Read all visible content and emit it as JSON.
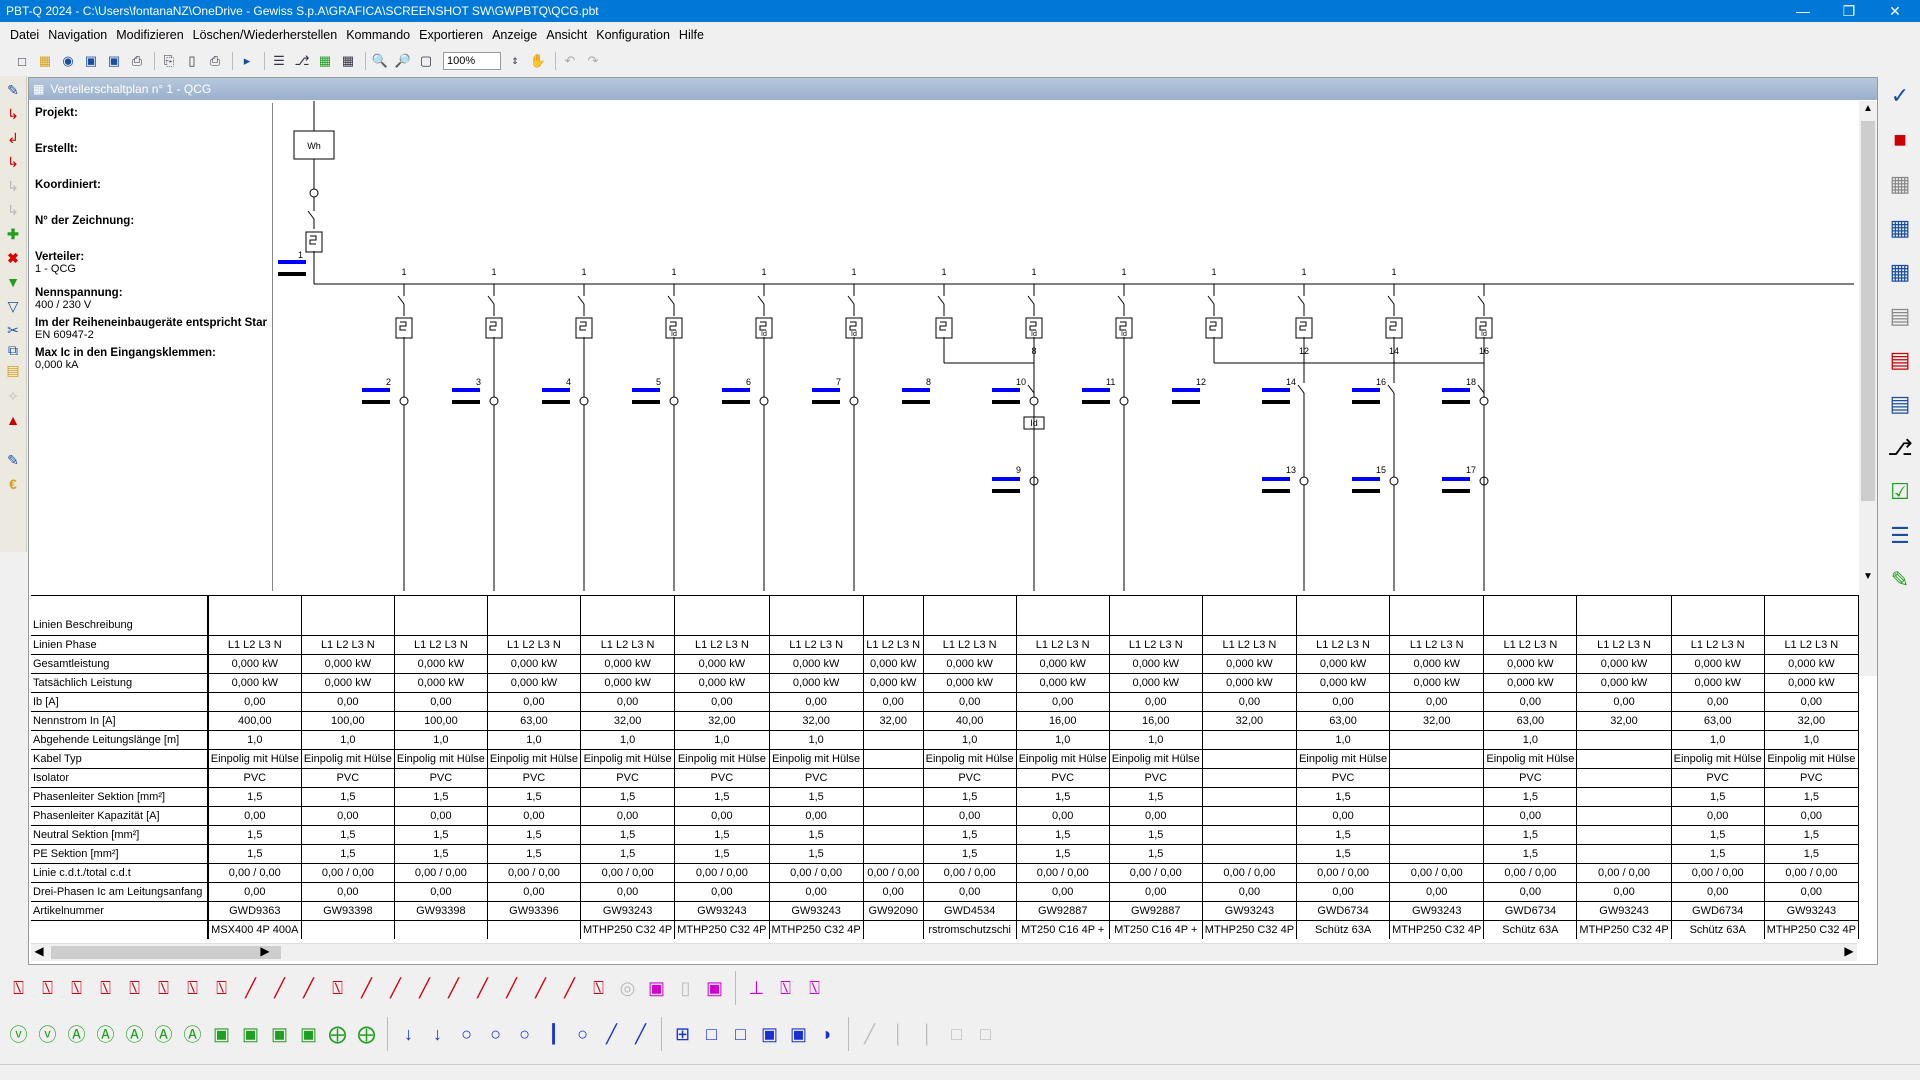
{
  "window": {
    "title": "PBT-Q 2024 - C:\\Users\\fontanaNZ\\OneDrive - Gewiss S.p.A\\GRAFICA\\SCREENSHOT SW\\GWPBTQ\\QCG.pbt"
  },
  "menu": [
    "Datei",
    "Navigation",
    "Modifizieren",
    "Löschen/Wiederherstellen",
    "Kommando",
    "Exportieren",
    "Anzeige",
    "Ansicht",
    "Konfiguration",
    "Hilfe"
  ],
  "toolbar": {
    "zoom": "100%"
  },
  "panel": {
    "title": "Verteilerschaltplan n° 1 - QCG"
  },
  "info": {
    "projekt": "Projekt:",
    "erstellt": "Erstellt:",
    "koordiniert": "Koordiniert:",
    "zeichnung": "N° der Zeichnung:",
    "verteiler_label": "Verteiler:",
    "verteiler_value": "1 - QCG",
    "nennspannung_label": "Nennspannung:",
    "nennspannung_value": "400 / 230 V",
    "reihen_label": "Im der Reiheneinbaugeräte entspricht Star",
    "reihen_value": "EN 60947-2",
    "maxic_label": "Max Ic in den Eingangsklemmen:",
    "maxic_value": "0,000 kA"
  },
  "diagram": {
    "meter": "Wh",
    "main_id": "1",
    "feeders": [
      {
        "id": "2",
        "bus": "1",
        "type": "br"
      },
      {
        "id": "3",
        "bus": "1",
        "type": "br"
      },
      {
        "id": "4",
        "bus": "1",
        "type": "br"
      },
      {
        "id": "5",
        "bus": "1",
        "type": "bd"
      },
      {
        "id": "6",
        "bus": "1",
        "type": "bd"
      },
      {
        "id": "7",
        "bus": "1",
        "type": "bd"
      },
      {
        "id": "8",
        "bus": "1",
        "type": "sub",
        "sub": "8",
        "low": "9"
      },
      {
        "id": "10",
        "bus": "1",
        "type": "bd"
      },
      {
        "id": "11",
        "bus": "1",
        "type": "bd"
      },
      {
        "id": "12",
        "bus": "1",
        "type": "sub",
        "sub": "12",
        "low": "13"
      },
      {
        "id": "14",
        "bus": "1",
        "type": "sub",
        "sub": "14",
        "low": "15"
      },
      {
        "id": "16",
        "bus": "1",
        "type": "sub",
        "sub": "16",
        "low": "17"
      },
      {
        "id": "18",
        "bus": "",
        "type": "bd"
      }
    ]
  },
  "grid": {
    "row_labels": [
      "Linien Beschreibung",
      "Linien Phase",
      "Gesamtleistung",
      "Tatsächlich Leistung",
      "Ib [A]",
      "Nennstrom In [A]",
      "Abgehende Leitungslänge [m]",
      "Kabel Typ",
      "Isolator",
      "Phasenleiter Sektion [mm²]",
      "Phasenleiter Kapazität [A]",
      "Neutral Sektion [mm²]",
      "PE Sektion [mm²]",
      "Linie c.d.t./total c.d.t",
      "Drei-Phasen Ic am Leitungsanfang",
      "Artikelnummer",
      ""
    ],
    "columns": [
      [
        "",
        "L1 L2 L3 N",
        "0,000 kW",
        "0,000 kW",
        "0,00",
        "400,00",
        "1,0",
        "Einpolig mit Hülse",
        "PVC",
        "1,5",
        "0,00",
        "1,5",
        "1,5",
        "0,00 / 0,00",
        "0,00",
        "GWD9363",
        "MSX400 4P 400A"
      ],
      [
        "",
        "L1 L2 L3 N",
        "0,000 kW",
        "0,000 kW",
        "0,00",
        "100,00",
        "1,0",
        "Einpolig mit Hülse",
        "PVC",
        "1,5",
        "0,00",
        "1,5",
        "1,5",
        "0,00 / 0,00",
        "0,00",
        "GW93398",
        ""
      ],
      [
        "",
        "L1 L2 L3 N",
        "0,000 kW",
        "0,000 kW",
        "0,00",
        "100,00",
        "1,0",
        "Einpolig mit Hülse",
        "PVC",
        "1,5",
        "0,00",
        "1,5",
        "1,5",
        "0,00 / 0,00",
        "0,00",
        "GW93398",
        ""
      ],
      [
        "",
        "L1 L2 L3 N",
        "0,000 kW",
        "0,000 kW",
        "0,00",
        "63,00",
        "1,0",
        "Einpolig mit Hülse",
        "PVC",
        "1,5",
        "0,00",
        "1,5",
        "1,5",
        "0,00 / 0,00",
        "0,00",
        "GW93396",
        ""
      ],
      [
        "",
        "L1 L2 L3 N",
        "0,000 kW",
        "0,000 kW",
        "0,00",
        "32,00",
        "1,0",
        "Einpolig mit Hülse",
        "PVC",
        "1,5",
        "0,00",
        "1,5",
        "1,5",
        "0,00 / 0,00",
        "0,00",
        "GW93243",
        "MTHP250 C32 4P"
      ],
      [
        "",
        "L1 L2 L3 N",
        "0,000 kW",
        "0,000 kW",
        "0,00",
        "32,00",
        "1,0",
        "Einpolig mit Hülse",
        "PVC",
        "1,5",
        "0,00",
        "1,5",
        "1,5",
        "0,00 / 0,00",
        "0,00",
        "GW93243",
        "MTHP250 C32 4P"
      ],
      [
        "",
        "L1 L2 L3 N",
        "0,000 kW",
        "0,000 kW",
        "0,00",
        "32,00",
        "1,0",
        "Einpolig mit Hülse",
        "PVC",
        "1,5",
        "0,00",
        "1,5",
        "1,5",
        "0,00 / 0,00",
        "0,00",
        "GW93243",
        "MTHP250 C32 4P"
      ],
      [
        "",
        "L1 L2 L3 N",
        "0,000 kW",
        "0,000 kW",
        "0,00",
        "32,00",
        "",
        "",
        "",
        "",
        "",
        "",
        "",
        "0,00 / 0,00",
        "0,00",
        "GW92090",
        ""
      ],
      [
        "",
        "L1 L2 L3 N",
        "0,000 kW",
        "0,000 kW",
        "0,00",
        "40,00",
        "1,0",
        "Einpolig mit Hülse",
        "PVC",
        "1,5",
        "0,00",
        "1,5",
        "1,5",
        "0,00 / 0,00",
        "0,00",
        "GWD4534",
        "rstromschutzschi"
      ],
      [
        "",
        "L1 L2 L3 N",
        "0,000 kW",
        "0,000 kW",
        "0,00",
        "16,00",
        "1,0",
        "Einpolig mit Hülse",
        "PVC",
        "1,5",
        "0,00",
        "1,5",
        "1,5",
        "0,00 / 0,00",
        "0,00",
        "GW92887",
        "MT250 C16 4P +"
      ],
      [
        "",
        "L1 L2 L3 N",
        "0,000 kW",
        "0,000 kW",
        "0,00",
        "16,00",
        "1,0",
        "Einpolig mit Hülse",
        "PVC",
        "1,5",
        "0,00",
        "1,5",
        "1,5",
        "0,00 / 0,00",
        "0,00",
        "GW92887",
        "MT250 C16 4P +"
      ],
      [
        "",
        "L1 L2 L3 N",
        "0,000 kW",
        "0,000 kW",
        "0,00",
        "32,00",
        "",
        "",
        "",
        "",
        "",
        "",
        "",
        "0,00 / 0,00",
        "0,00",
        "GW93243",
        "MTHP250 C32 4P"
      ],
      [
        "",
        "L1 L2 L3 N",
        "0,000 kW",
        "0,000 kW",
        "0,00",
        "63,00",
        "1,0",
        "Einpolig mit Hülse",
        "PVC",
        "1,5",
        "0,00",
        "1,5",
        "1,5",
        "0,00 / 0,00",
        "0,00",
        "GWD6734",
        "Schütz 63A"
      ],
      [
        "",
        "L1 L2 L3 N",
        "0,000 kW",
        "0,000 kW",
        "0,00",
        "32,00",
        "",
        "",
        "",
        "",
        "",
        "",
        "",
        "0,00 / 0,00",
        "0,00",
        "GW93243",
        "MTHP250 C32 4P"
      ],
      [
        "",
        "L1 L2 L3 N",
        "0,000 kW",
        "0,000 kW",
        "0,00",
        "63,00",
        "1,0",
        "Einpolig mit Hülse",
        "PVC",
        "1,5",
        "0,00",
        "1,5",
        "1,5",
        "0,00 / 0,00",
        "0,00",
        "GWD6734",
        "Schütz 63A"
      ],
      [
        "",
        "L1 L2 L3 N",
        "0,000 kW",
        "0,000 kW",
        "0,00",
        "32,00",
        "",
        "",
        "",
        "",
        "",
        "",
        "",
        "0,00 / 0,00",
        "0,00",
        "GW93243",
        "MTHP250 C32 4P"
      ],
      [
        "",
        "L1 L2 L3 N",
        "0,000 kW",
        "0,000 kW",
        "0,00",
        "63,00",
        "1,0",
        "Einpolig mit Hülse",
        "PVC",
        "1,5",
        "0,00",
        "1,5",
        "1,5",
        "0,00 / 0,00",
        "0,00",
        "GWD6734",
        "Schütz 63A"
      ],
      [
        "",
        "L1 L2 L3 N",
        "0,000 kW",
        "0,000 kW",
        "0,00",
        "32,00",
        "1,0",
        "Einpolig mit Hülse",
        "PVC",
        "1,5",
        "0,00",
        "1,5",
        "1,5",
        "0,00 / 0,00",
        "0,00",
        "GW93243",
        "MTHP250 C32 4P"
      ]
    ]
  },
  "colors": {
    "titlebar": "#0078d7",
    "bus_blue": "#0000ff",
    "panel_header": "#9ab0cb",
    "palette_red": "#d0021b",
    "palette_green": "#1f9e1f",
    "palette_blue": "#1a2fd0",
    "palette_magenta": "#d000d0"
  }
}
